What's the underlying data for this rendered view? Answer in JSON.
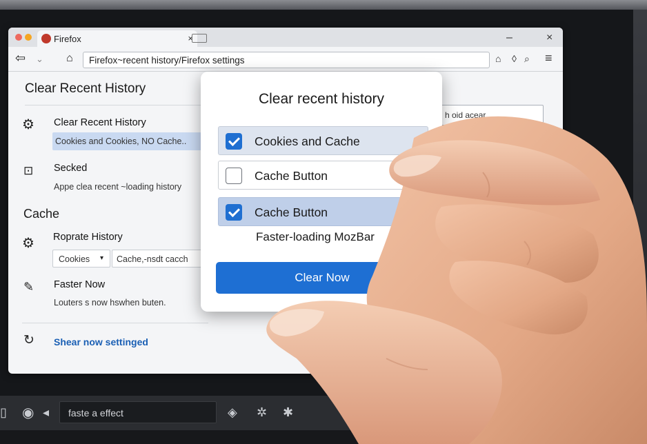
{
  "browser": {
    "tab_title": "Firefox",
    "tab_close": "×",
    "minimize": "–",
    "close": "×",
    "url": "Firefox~recent history/Firefox settings",
    "right_field_text": "h oid acear"
  },
  "settings": {
    "section_title": "Clear Recent History",
    "row1_label": "Clear Recent History",
    "row1_sub": "Cookies and Cookies, NO Cache..",
    "row2_label": "Secked",
    "row2_sub": "Appe clea recent ~loading history",
    "section2_title": "Cache",
    "row3_label": "Roprate History",
    "row3_select": "Cookies",
    "row3_field": "Cache,-nsdt cacch",
    "row4_label": "Faster Now",
    "row4_sub": "Louters s now hswhen buten.",
    "link_label": "Shear now settinged"
  },
  "dialog": {
    "title": "Clear recent history",
    "options": [
      {
        "label": "Cookies and Cache",
        "checked": true
      },
      {
        "label": "Cache Button",
        "checked": false
      },
      {
        "label": "Cache Button",
        "checked": true
      }
    ],
    "note": "Faster-loading MozBar",
    "button_label": "Clear Now"
  },
  "taskbar": {
    "field_text": "faste a effect"
  },
  "colors": {
    "accent": "#1e6fd3",
    "highlight": "#c9d9f1",
    "link": "#1a5fb4"
  }
}
